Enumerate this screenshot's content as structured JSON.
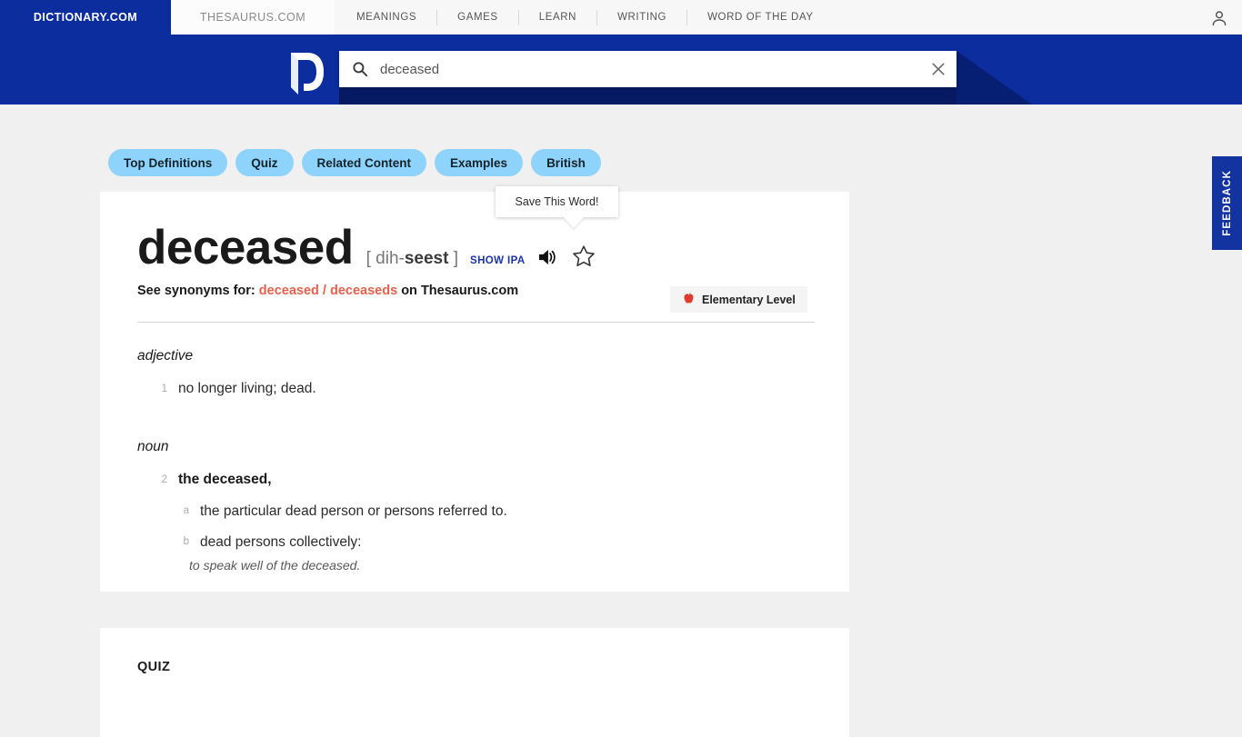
{
  "topnav": {
    "brand_tab": "DICTIONARY.COM",
    "thesaurus_tab": "THESAURUS.COM",
    "links": [
      {
        "label": "MEANINGS"
      },
      {
        "label": "GAMES"
      },
      {
        "label": "LEARN"
      },
      {
        "label": "WRITING"
      },
      {
        "label": "WORD OF THE DAY"
      }
    ],
    "account_icon": "user-icon"
  },
  "search": {
    "value": "deceased",
    "placeholder": "Search dictionary.com",
    "search_icon": "search-icon",
    "clear_icon": "close-icon",
    "logo": "dictionary-d-logo"
  },
  "pills": [
    {
      "label": "Top Definitions"
    },
    {
      "label": "Quiz"
    },
    {
      "label": "Related Content"
    },
    {
      "label": "Examples"
    },
    {
      "label": "British"
    }
  ],
  "tooltip": {
    "text": "Save This Word!"
  },
  "entry": {
    "headword": "deceased",
    "pron_open": "[ dih-",
    "pron_stress": "seest",
    "pron_close": " ]",
    "show_ipa": "SHOW IPA",
    "audio_icon": "speaker-icon",
    "save_icon": "star-icon",
    "synonyms": {
      "prefix": "See synonyms for:",
      "link1": "deceased",
      "separator": "/",
      "link2": "deceaseds",
      "suffix_on": "on",
      "suffix_site": "Thesaurus.com"
    },
    "level_badge": {
      "icon": "apple-icon",
      "label": "Elementary Level"
    },
    "parts_of_speech": [
      {
        "pos": "adjective",
        "senses": [
          {
            "num": "1",
            "text": "no longer living; dead.",
            "bold": false,
            "subsenses": []
          }
        ]
      },
      {
        "pos": "noun",
        "senses": [
          {
            "num": "2",
            "text": "the deceased,",
            "bold": true,
            "subsenses": [
              {
                "letter": "a",
                "text": "the particular dead person or persons referred to.",
                "example": ""
              },
              {
                "letter": "b",
                "text": "dead persons collectively:",
                "example": "to speak well of the deceased."
              }
            ]
          }
        ]
      }
    ]
  },
  "quiz": {
    "title": "QUIZ"
  },
  "feedback": {
    "label": "FEEDBACK"
  },
  "colors": {
    "brand_blue": "#0b2d9e",
    "pill_blue": "#8ed3fb",
    "synonym_red": "#e8604c",
    "ipa_blue": "#1a33a8",
    "page_bg": "#f0f0f0"
  }
}
